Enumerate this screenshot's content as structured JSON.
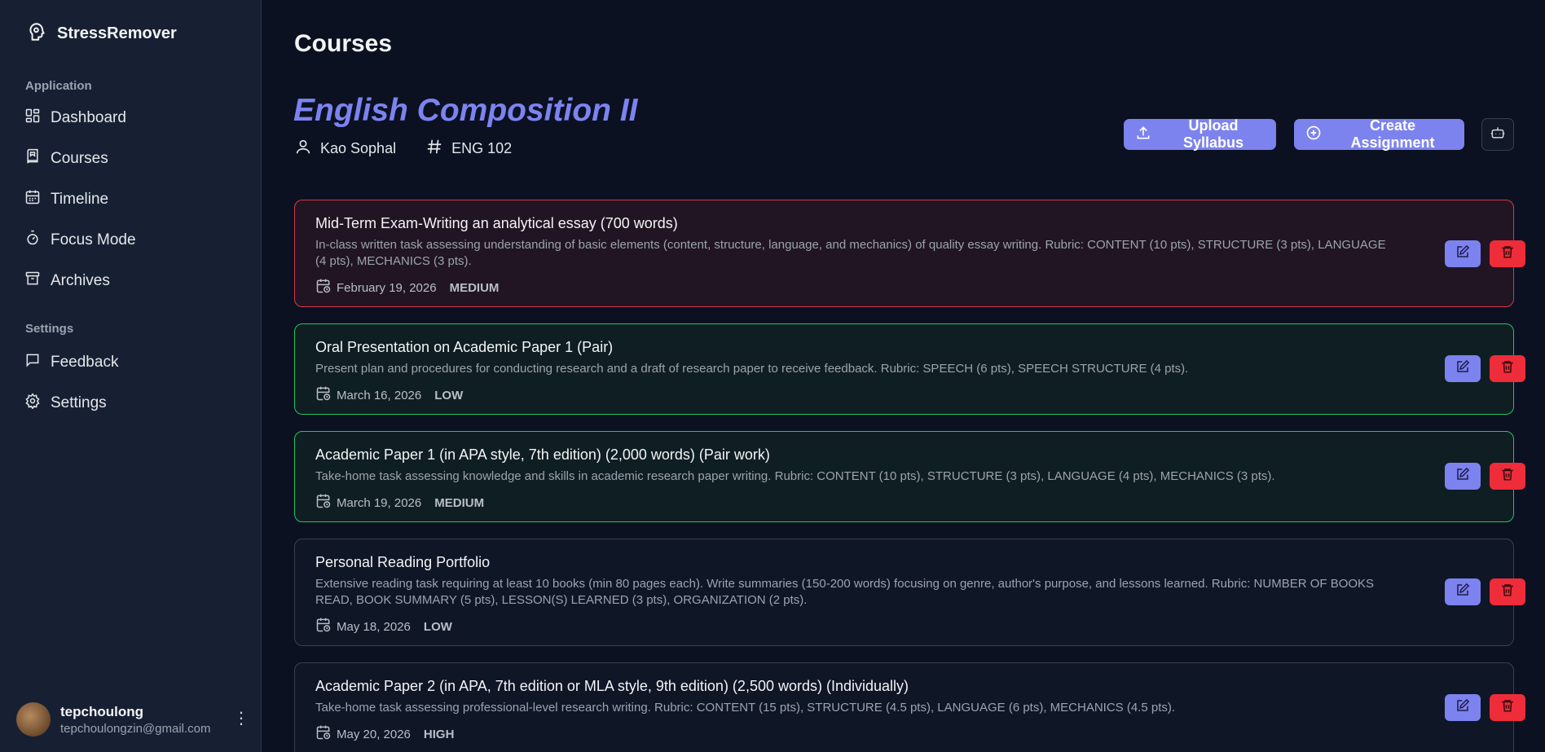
{
  "app": {
    "name": "StressRemover"
  },
  "sidebar": {
    "section_application": "Application",
    "items": [
      {
        "label": "Dashboard",
        "icon": "dashboard-icon"
      },
      {
        "label": "Courses",
        "icon": "book-icon"
      },
      {
        "label": "Timeline",
        "icon": "calendar-icon"
      },
      {
        "label": "Focus Mode",
        "icon": "timer-icon"
      },
      {
        "label": "Archives",
        "icon": "archive-icon"
      }
    ],
    "section_settings": "Settings",
    "settings_items": [
      {
        "label": "Feedback",
        "icon": "message-icon"
      },
      {
        "label": "Settings",
        "icon": "gear-icon"
      }
    ],
    "user": {
      "name": "tepchoulong",
      "email": "tepchoulongzin@gmail.com"
    }
  },
  "page": {
    "title": "Courses"
  },
  "course": {
    "name": "English Composition II",
    "instructor": "Kao Sophal",
    "code": "ENG 102"
  },
  "actions": {
    "upload_label": "Upload Syllabus",
    "create_label": "Create Assignment"
  },
  "assignments": [
    {
      "title": "Mid-Term Exam-Writing an analytical essay (700 words)",
      "description": "In-class written task assessing understanding of basic elements (content, structure, language, and mechanics) of quality essay writing. Rubric: CONTENT (10 pts), STRUCTURE (3 pts), LANGUAGE (4 pts), MECHANICS (3 pts).",
      "date": "February 19, 2026",
      "priority": "MEDIUM",
      "status_color": "#dc3545"
    },
    {
      "title": "Oral Presentation on Academic Paper 1 (Pair)",
      "description": "Present plan and procedures for conducting research and a draft of research paper to receive feedback. Rubric: SPEECH (6 pts), SPEECH STRUCTURE (4 pts).",
      "date": "March 16, 2026",
      "priority": "LOW",
      "status_color": "#22c55e"
    },
    {
      "title": "Academic Paper 1 (in APA style, 7th edition) (2,000 words) (Pair work)",
      "description": "Take-home task assessing knowledge and skills in academic research paper writing. Rubric: CONTENT (10 pts), STRUCTURE (3 pts), LANGUAGE (4 pts), MECHANICS (3 pts).",
      "date": "March 19, 2026",
      "priority": "MEDIUM",
      "status_color": "#22c55e"
    },
    {
      "title": "Personal Reading Portfolio",
      "description": "Extensive reading task requiring at least 10 books (min 80 pages each). Write summaries (150-200 words) focusing on genre, author's purpose, and lessons learned. Rubric: NUMBER OF BOOKS READ, BOOK SUMMARY (5 pts), LESSON(S) LEARNED (3 pts), ORGANIZATION (2 pts).",
      "date": "May 18, 2026",
      "priority": "LOW",
      "status_color": "#384152"
    },
    {
      "title": "Academic Paper 2 (in APA, 7th edition or MLA style, 9th edition) (2,500 words) (Individually)",
      "description": "Take-home task assessing professional-level research writing. Rubric: CONTENT (15 pts), STRUCTURE (4.5 pts), LANGUAGE (6 pts), MECHANICS (4.5 pts).",
      "date": "May 20, 2026",
      "priority": "HIGH",
      "status_color": "#384152"
    }
  ],
  "colors": {
    "accent": "#7c83ee",
    "danger": "#ef2c3a",
    "background": "#0b1120",
    "sidebar": "#172033"
  }
}
